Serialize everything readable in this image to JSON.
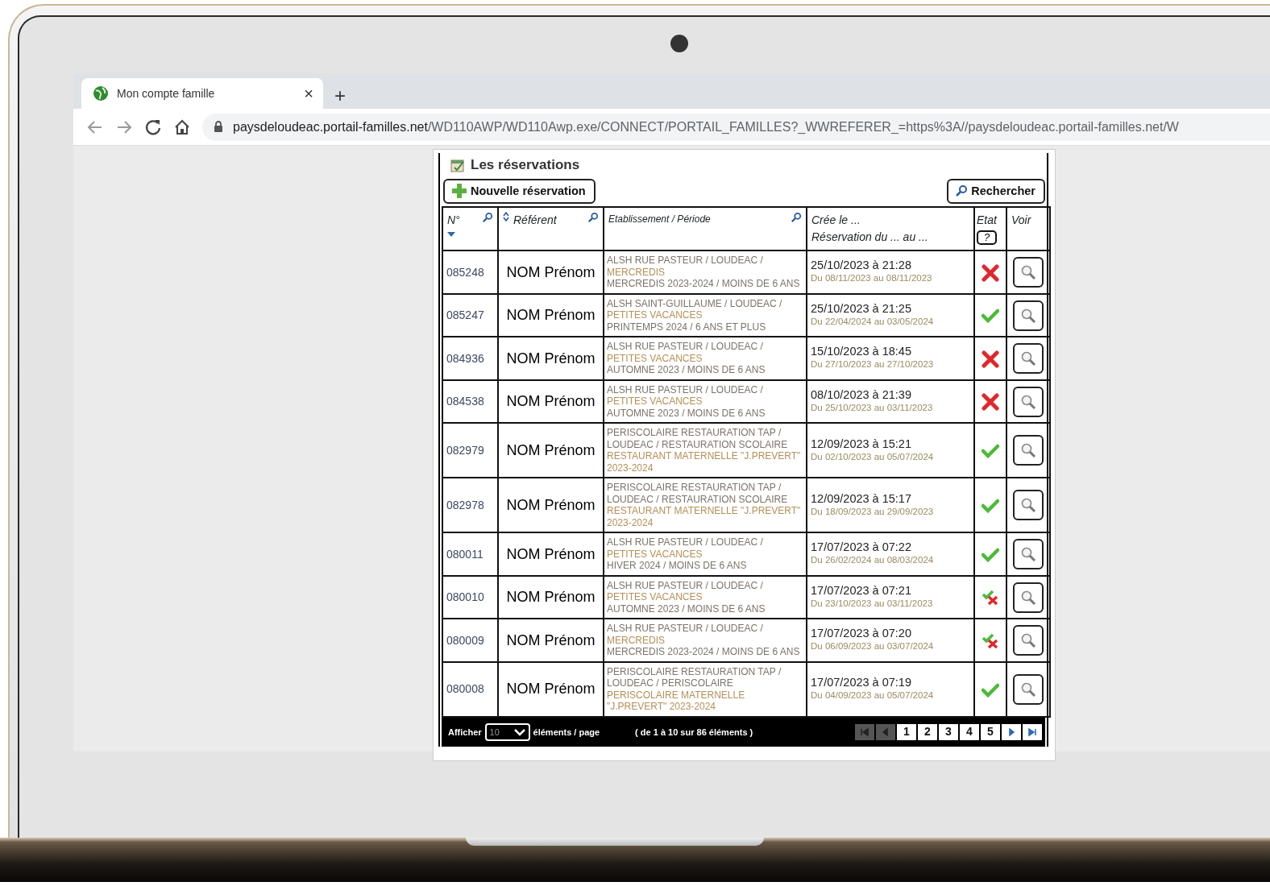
{
  "browser": {
    "tab_title": "Mon compte famille",
    "tab_close": "×",
    "new_tab": "+",
    "url_host": "paysdeloudeac.portail-familles.net",
    "url_path": "/WD110AWP/WD110Awp.exe/CONNECT/PORTAIL_FAMILLES?_WWREFERER_=https%3A//paysdeloudeac.portail-familles.net/W"
  },
  "page": {
    "title": "Les réservations",
    "new_button": "Nouvelle réservation",
    "search_button": "Rechercher",
    "columns": [
      {
        "lines": [
          "N°"
        ],
        "search": true,
        "sorted_desc": true,
        "sortable": false
      },
      {
        "lines": [
          "Référent"
        ],
        "search": true,
        "sorted_desc": false,
        "sortable": true
      },
      {
        "lines": [
          "Etablissement / Période"
        ],
        "search": true,
        "sorted_desc": false,
        "sortable": false
      },
      {
        "lines": [
          "Crée le ...",
          "Réservation du ... au ..."
        ],
        "search": false,
        "sorted_desc": false,
        "sortable": false
      },
      {
        "lines": [
          "Etat"
        ],
        "help": "?",
        "search": false,
        "sorted_desc": false,
        "sortable": false
      },
      {
        "lines": [
          "Voir"
        ],
        "search": false,
        "sorted_desc": false,
        "sortable": false
      }
    ],
    "rows": [
      {
        "number": "085248",
        "referent": "NOM Prénom",
        "etablissement": [
          "ALSH RUE PASTEUR / LOUDEAC /",
          "MERCREDIS",
          "MERCREDIS 2023-2024 / MOINS DE 6 ANS"
        ],
        "created": "25/10/2023 à 21:28",
        "period": "Du 08/11/2023 au 08/11/2023",
        "kind": "refused"
      },
      {
        "number": "085247",
        "referent": "NOM Prénom",
        "etablissement": [
          "ALSH SAINT-GUILLAUME / LOUDEAC /",
          "PETITES VACANCES",
          "PRINTEMPS 2024 / 6 ANS ET PLUS"
        ],
        "created": "25/10/2023 à 21:25",
        "period": "Du 22/04/2024 au 03/05/2024",
        "kind": "accepted"
      },
      {
        "number": "084936",
        "referent": "NOM Prénom",
        "etablissement": [
          "ALSH RUE PASTEUR / LOUDEAC /",
          "PETITES VACANCES",
          "AUTOMNE 2023 / MOINS DE 6 ANS"
        ],
        "created": "15/10/2023 à 18:45",
        "period": "Du 27/10/2023 au 27/10/2023",
        "kind": "refused"
      },
      {
        "number": "084538",
        "referent": "NOM Prénom",
        "etablissement": [
          "ALSH RUE PASTEUR / LOUDEAC /",
          "PETITES VACANCES",
          "AUTOMNE 2023 / MOINS DE 6 ANS"
        ],
        "created": "08/10/2023 à 21:39",
        "period": "Du 25/10/2023 au 03/11/2023",
        "kind": "refused"
      },
      {
        "number": "082979",
        "referent": "NOM Prénom",
        "etablissement": [
          "PERISCOLAIRE RESTAURATION TAP / LOUDEAC / RESTAURATION SCOLAIRE",
          "RESTAURANT MATERNELLE \"J.PREVERT\" 2023-2024"
        ],
        "created": "12/09/2023 à 15:21",
        "period": "Du 02/10/2023 au 05/07/2024",
        "kind": "accepted"
      },
      {
        "number": "082978",
        "referent": "NOM Prénom",
        "etablissement": [
          "PERISCOLAIRE RESTAURATION TAP / LOUDEAC / RESTAURATION SCOLAIRE",
          "RESTAURANT MATERNELLE \"J.PREVERT\" 2023-2024"
        ],
        "created": "12/09/2023 à 15:17",
        "period": "Du 18/09/2023 au 29/09/2023",
        "kind": "accepted"
      },
      {
        "number": "080011",
        "referent": "NOM Prénom",
        "etablissement": [
          "ALSH RUE PASTEUR / LOUDEAC /",
          "PETITES VACANCES",
          "HIVER 2024 / MOINS DE 6 ANS"
        ],
        "created": "17/07/2023 à 07:22",
        "period": "Du 26/02/2024 au 08/03/2024",
        "kind": "accepted"
      },
      {
        "number": "080010",
        "referent": "NOM Prénom",
        "etablissement": [
          "ALSH RUE PASTEUR / LOUDEAC /",
          "PETITES VACANCES",
          "AUTOMNE 2023 / MOINS DE 6 ANS"
        ],
        "created": "17/07/2023 à 07:21",
        "period": "Du 23/10/2023 au 03/11/2023",
        "kind": "partial"
      },
      {
        "number": "080009",
        "referent": "NOM Prénom",
        "etablissement": [
          "ALSH RUE PASTEUR / LOUDEAC /",
          "MERCREDIS",
          "MERCREDIS 2023-2024 / MOINS DE 6 ANS"
        ],
        "created": "17/07/2023 à 07:20",
        "period": "Du 06/09/2023 au 03/07/2024",
        "kind": "partial"
      },
      {
        "number": "080008",
        "referent": "NOM Prénom",
        "etablissement": [
          "PERISCOLAIRE RESTAURATION TAP / LOUDEAC / PERISCOLAIRE",
          "PERISCOLAIRE MATERNELLE \"J.PREVERT\" 2023-2024"
        ],
        "created": "17/07/2023 à 07:19",
        "period": "Du 04/09/2023 au 05/07/2024",
        "kind": "accepted"
      }
    ],
    "footer": {
      "show_label": "Afficher",
      "page_size": "10",
      "per_page_label": "éléments / page",
      "range": "( de 1 à 10 sur 86 éléments )",
      "pager": [
        {
          "kind": "first",
          "disabled": true
        },
        {
          "kind": "prev",
          "disabled": true
        },
        {
          "kind": "page",
          "label": "1"
        },
        {
          "kind": "page",
          "label": "2"
        },
        {
          "kind": "page",
          "label": "3"
        },
        {
          "kind": "page",
          "label": "4"
        },
        {
          "kind": "page",
          "label": "5"
        },
        {
          "kind": "next",
          "disabled": false
        },
        {
          "kind": "last",
          "disabled": false
        }
      ]
    }
  }
}
